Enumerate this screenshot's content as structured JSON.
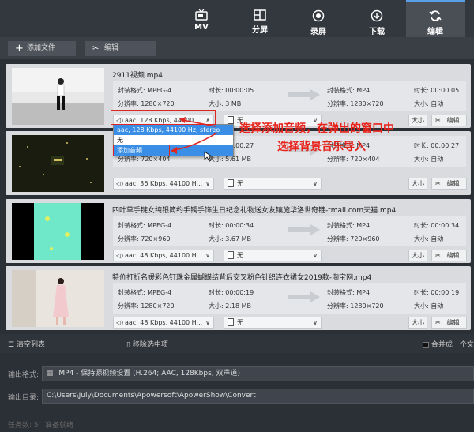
{
  "tabs": [
    {
      "label": "MV",
      "icon": "tv-icon"
    },
    {
      "label": "分屏",
      "icon": "split-screen-icon"
    },
    {
      "label": "录屏",
      "icon": "record-icon"
    },
    {
      "label": "下载",
      "icon": "download-icon"
    },
    {
      "label": "编辑",
      "icon": "refresh-icon",
      "active": true
    }
  ],
  "toolbar": {
    "add_file": "添加文件",
    "edit": "编辑"
  },
  "labels": {
    "format": "封装格式:",
    "duration": "时长:",
    "resolution": "分辨率:",
    "size": "大小:",
    "size_button": "大小",
    "edit_button": "编辑",
    "subtitle_none": "无"
  },
  "items": [
    {
      "filename": "2911视频.mp4",
      "src_format": "MPEG-4",
      "src_duration": "00:00:05",
      "src_resolution": "1280×720",
      "src_size": "3 MB",
      "dst_format": "MP4",
      "dst_duration": "00:00:05",
      "dst_resolution": "1280×720",
      "dst_size": "自动",
      "audio": "aac, 128 Kbps, 44100 ..."
    },
    {
      "filename": "",
      "src_format": "",
      "src_duration": "00:00:27",
      "src_resolution": "720×404",
      "src_size": "5.61 MB",
      "dst_format": "MP4",
      "dst_duration": "00:00:27",
      "dst_resolution": "720×404",
      "dst_size": "自动",
      "audio": "aac, 36 Kbps, 44100 H..."
    },
    {
      "filename": "四叶草手链女纯银简约手镯手饰生日纪念礼物送女友镶施华洛世奇链-tmall.com天猫.mp4",
      "src_format": "MPEG-4",
      "src_duration": "00:00:34",
      "src_resolution": "720×960",
      "src_size": "3.67 MB",
      "dst_format": "MP4",
      "dst_duration": "00:00:34",
      "dst_resolution": "720×960",
      "dst_size": "自动",
      "audio": "aac, 48 Kbps, 44100 H..."
    },
    {
      "filename": "特价打折名媛彩色钉珠金属蝴蝶结背后交叉粉色针织连衣裙女2019款-淘宝网.mp4",
      "src_format": "MPEG-4",
      "src_duration": "00:00:19",
      "src_resolution": "1280×720",
      "src_size": "2.18 MB",
      "dst_format": "MP4",
      "dst_duration": "00:00:19",
      "dst_resolution": "1280×720",
      "dst_size": "自动",
      "audio": "aac, 48 Kbps, 44100 H..."
    }
  ],
  "dropdown": {
    "options": [
      "aac, 128 Kbps, 44100 Hz, stereo",
      "无",
      "添加音频..."
    ]
  },
  "annotation": {
    "line1": "选择添加音频，在弹出的窗口中",
    "line2": "选择背景音乐导入"
  },
  "bottom": {
    "clear_list": "清空列表",
    "remove_selected": "移除选中项",
    "merge": "合并成一个文",
    "output_format_label": "输出格式:",
    "output_format_value": "MP4 - 保持源视频设置 (H.264; AAC, 128Kbps, 双声道)",
    "output_dir_label": "输出目录:",
    "output_dir_value": "C:\\Users\\July\\Documents\\Apowersoft\\ApowerShow\\Convert",
    "task_count": "任务数: 5",
    "status": "准备就绪"
  },
  "colors": {
    "accent": "#5aa0e8",
    "annotation": "#e8231c",
    "selection": "#3a8ee6"
  }
}
